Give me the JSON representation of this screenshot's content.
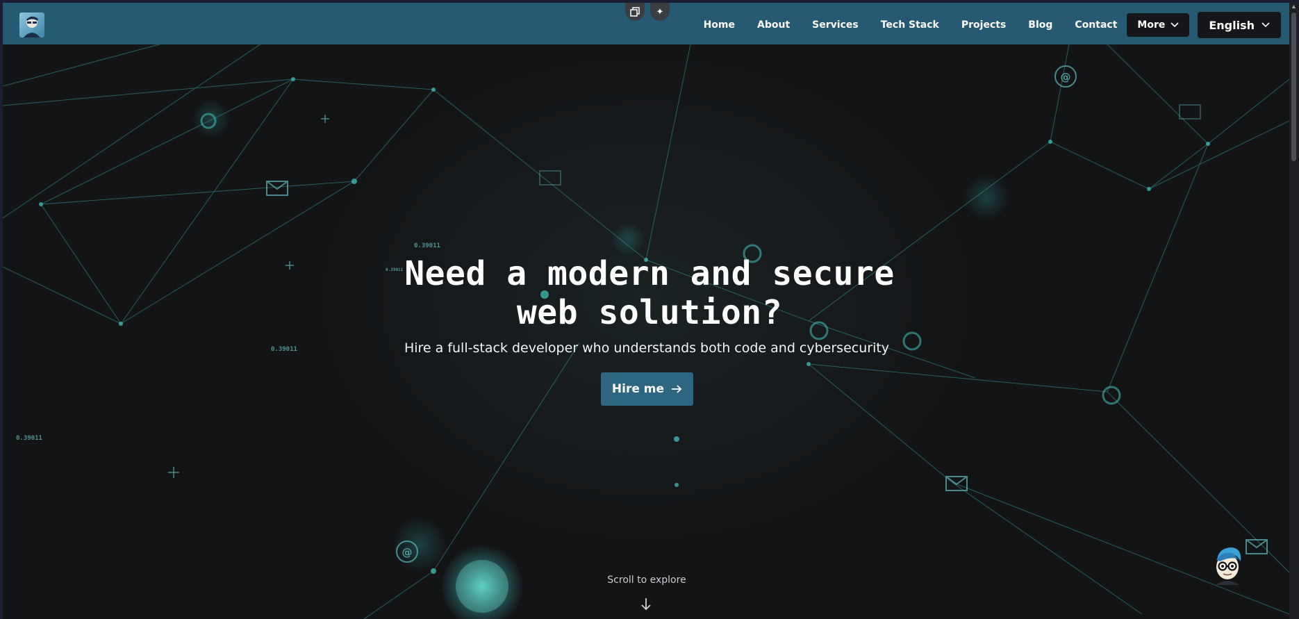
{
  "nav": {
    "links": [
      "Home",
      "About",
      "Services",
      "Tech Stack",
      "Projects",
      "Blog",
      "Contact"
    ],
    "more_label": "More",
    "language_label": "English"
  },
  "hero": {
    "headline_line1": "Need a modern and secure",
    "headline_line2": "web solution?",
    "subtitle": "Hire a full-stack developer who understands both code and cybersecurity",
    "cta_label": "Hire me",
    "scroll_hint": "Scroll to explore"
  },
  "decor": {
    "floating_values": [
      "0.39011",
      "0.39011",
      "0.39011",
      "0.39011"
    ]
  },
  "colors": {
    "navbar": "#255a72",
    "accent": "#2d6680",
    "network": "#3fb6b0",
    "background": "#131416"
  },
  "icons": [
    "logo",
    "copy-window-icon",
    "sparkle-icon",
    "chevron-down-icon",
    "arrow-right-icon",
    "arrow-down-icon",
    "mail-icon",
    "at-icon",
    "assistant-avatar"
  ]
}
